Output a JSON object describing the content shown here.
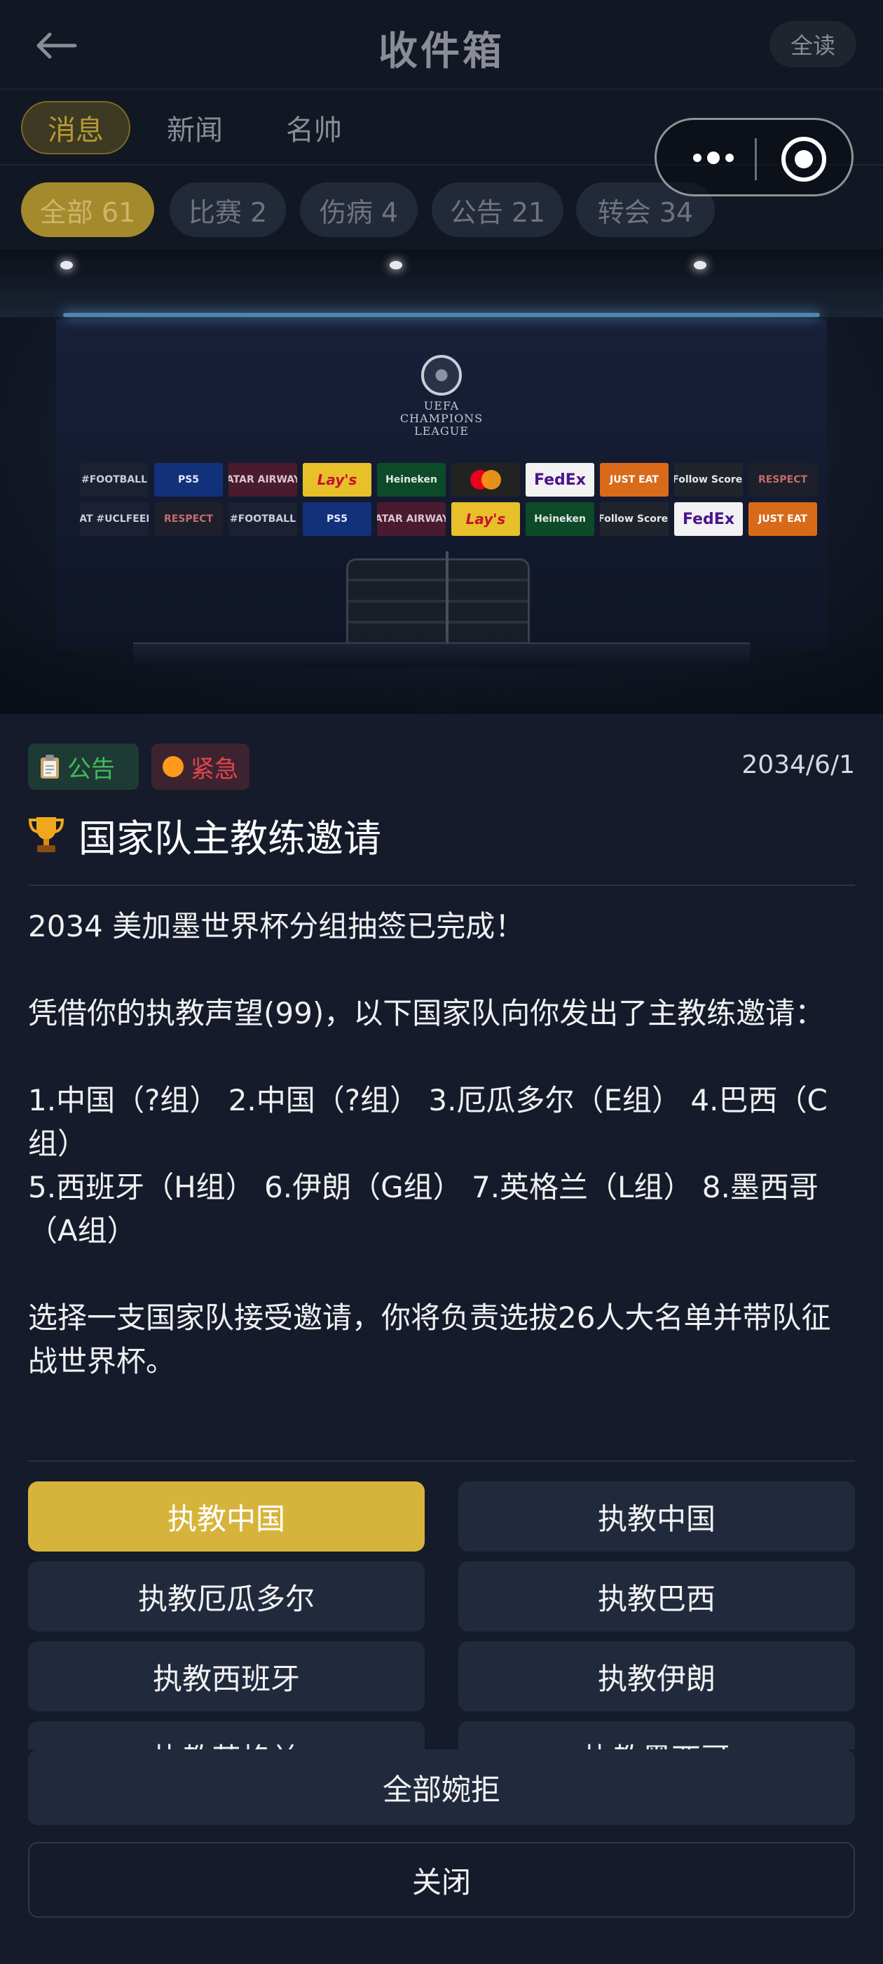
{
  "header": {
    "title": "收件箱",
    "read_all": "全读"
  },
  "tabs": [
    {
      "label": "消息"
    },
    {
      "label": "新闻"
    },
    {
      "label": "名帅"
    }
  ],
  "filters": [
    {
      "label": "全部 61"
    },
    {
      "label": "比赛 2"
    },
    {
      "label": "伤病 4"
    },
    {
      "label": "公告 21"
    },
    {
      "label": "转会 34"
    }
  ],
  "hero": {
    "logo_lines": [
      "UEFA",
      "CHAMPIONS",
      "LEAGUE"
    ],
    "sponsors_row1": [
      "#FOOTBALL",
      "PS5",
      "QATAR AIRWAYS",
      "Lay's",
      "Heineken",
      "",
      "FedEx",
      "JUST EAT",
      "iFollow Scores",
      "RESPECT"
    ],
    "sponsors_row2": [
      "#THAT #UCLFEELING",
      "RESPECT",
      "#FOOTBALL",
      "PS5",
      "QATAR AIRWAYS",
      "Lay's",
      "Heineken",
      "iFollow Scores",
      "FedEx",
      "JUST EAT"
    ]
  },
  "message": {
    "tags": {
      "announce": "公告",
      "urgent": "紧急"
    },
    "date": "2034/6/1",
    "title_icon": "🏆",
    "title": "国家队主教练邀请",
    "paragraphs": {
      "p1": "2034 美加墨世界杯分组抽签已完成！",
      "p2": "凭借你的执教声望(99)，以下国家队向你发出了主教练邀请：",
      "p3a": "1.中国（?组）  2.中国（?组）  3.厄瓜多尔（E组）  4.巴西（C组）",
      "p3b": "5.西班牙（H组）  6.伊朗（G组）  7.英格兰（L组）  8.墨西哥（A组）",
      "p4": "选择一支国家队接受邀请，你将负责选拔26人大名单并带队征战世界杯。"
    }
  },
  "options": [
    {
      "label": "执教中国"
    },
    {
      "label": "执教中国"
    },
    {
      "label": "执教厄瓜多尔"
    },
    {
      "label": "执教巴西"
    },
    {
      "label": "执教西班牙"
    },
    {
      "label": "执教伊朗"
    },
    {
      "label": "执教英格兰"
    },
    {
      "label": "执教墨西哥"
    }
  ],
  "footer": {
    "decline_all": "全部婉拒",
    "close": "关闭"
  },
  "colors": {
    "accent_gold": "#d6b43b",
    "announce_green": "#43b85c",
    "urgent_red": "#e0444c"
  }
}
